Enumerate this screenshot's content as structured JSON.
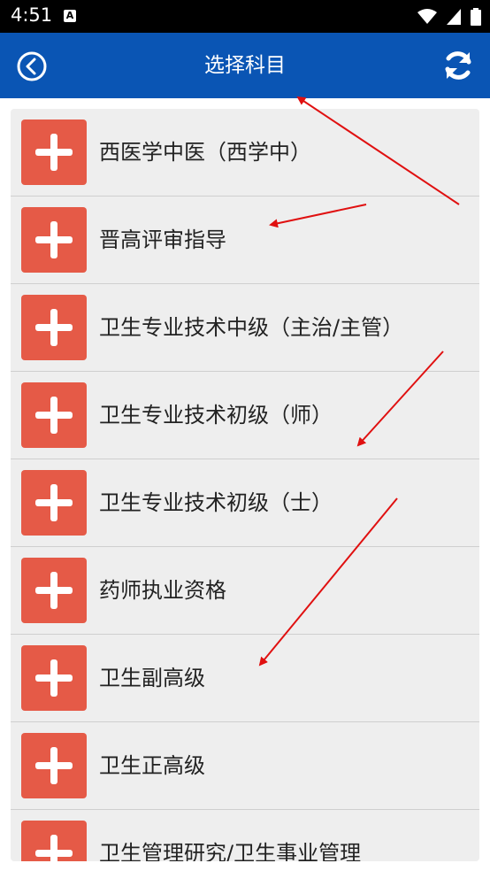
{
  "status_bar": {
    "time": "4:51",
    "indicator": "A"
  },
  "header": {
    "title": "选择科目",
    "back_icon": "back-circle-icon",
    "refresh_icon": "refresh-icon",
    "color": "#0a55b4"
  },
  "subjects": {
    "accent": "#e55a47",
    "items": [
      {
        "label": "西医学中医（西学中）"
      },
      {
        "label": "晋高评审指导"
      },
      {
        "label": "卫生专业技术中级（主治/主管）"
      },
      {
        "label": "卫生专业技术初级（师）"
      },
      {
        "label": "卫生专业技术初级（士）"
      },
      {
        "label": "药师执业资格"
      },
      {
        "label": "卫生副高级"
      },
      {
        "label": "卫生正高级"
      },
      {
        "label": "卫生管理研究/卫生事业管理"
      }
    ]
  },
  "annotations": {
    "arrow_color": "#e01010"
  }
}
